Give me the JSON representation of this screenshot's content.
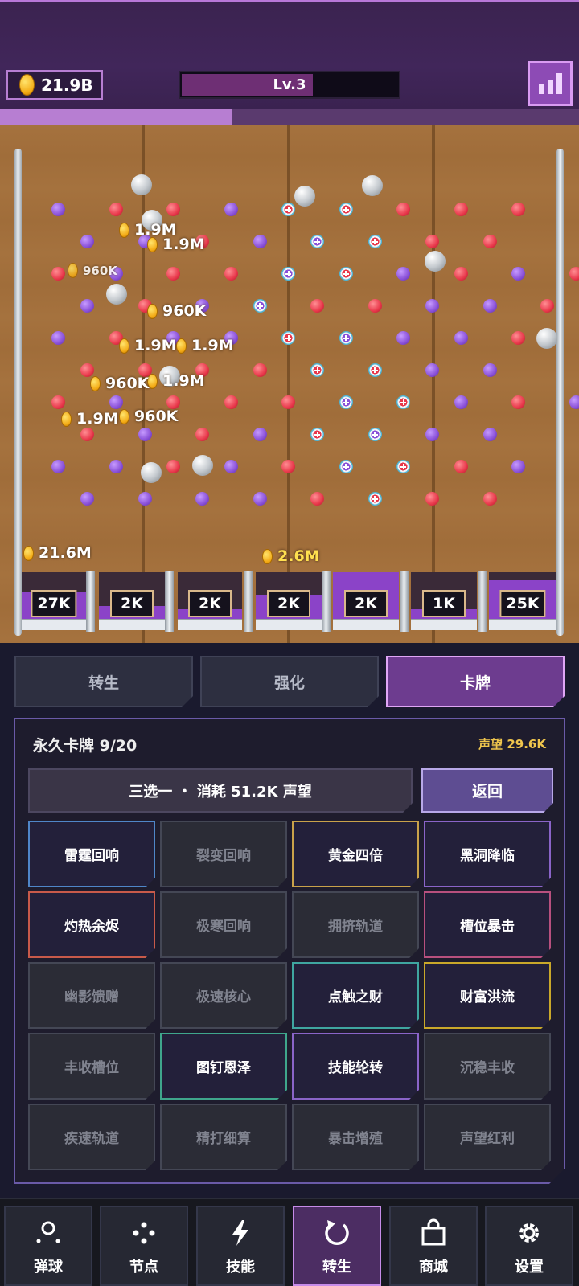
{
  "hud": {
    "gold": "21.9B",
    "level": "Lv.3",
    "level_progress": 0.6,
    "xp_progress": 0.4
  },
  "board": {
    "floating_values": [
      "1.9M",
      "1.9M",
      "960K",
      "960K",
      "1.9M",
      "1.9M",
      "1.9M",
      "960K",
      "1.9M",
      "960K"
    ],
    "slot_payouts": [
      "27K",
      "2K",
      "2K",
      "2K",
      "2K",
      "1K",
      "25K"
    ],
    "slot_winnings": [
      "21.6M",
      "2.6M"
    ]
  },
  "tabs": [
    {
      "label": "转生",
      "active": false
    },
    {
      "label": "强化",
      "active": false
    },
    {
      "label": "卡牌",
      "active": true
    }
  ],
  "cards": {
    "title": "永久卡牌 9/20",
    "prestige": "声望 29.6K",
    "pick_label": "三选一 ・ 消耗 51.2K 声望",
    "back_label": "返回",
    "items": [
      {
        "label": "雷霆回响",
        "owned": true,
        "color": "#4f86c8"
      },
      {
        "label": "裂变回响",
        "owned": false,
        "color": "#444755"
      },
      {
        "label": "黄金四倍",
        "owned": true,
        "color": "#c9a24a"
      },
      {
        "label": "黑洞降临",
        "owned": true,
        "color": "#8a64c8"
      },
      {
        "label": "灼热余烬",
        "owned": true,
        "color": "#c85a4a"
      },
      {
        "label": "极寒回响",
        "owned": false,
        "color": "#444755"
      },
      {
        "label": "拥挤轨道",
        "owned": false,
        "color": "#444755"
      },
      {
        "label": "槽位暴击",
        "owned": true,
        "color": "#b8507e"
      },
      {
        "label": "幽影馈赠",
        "owned": false,
        "color": "#444755"
      },
      {
        "label": "极速核心",
        "owned": false,
        "color": "#444755"
      },
      {
        "label": "点触之财",
        "owned": true,
        "color": "#3fa6a0"
      },
      {
        "label": "财富洪流",
        "owned": true,
        "color": "#c9a82a"
      },
      {
        "label": "丰收槽位",
        "owned": false,
        "color": "#444755"
      },
      {
        "label": "图钉恩泽",
        "owned": true,
        "color": "#3fa68c"
      },
      {
        "label": "技能轮转",
        "owned": true,
        "color": "#8a64c8"
      },
      {
        "label": "沉稳丰收",
        "owned": false,
        "color": "#444755"
      },
      {
        "label": "疾速轨道",
        "owned": false,
        "color": "#444755"
      },
      {
        "label": "精打细算",
        "owned": false,
        "color": "#444755"
      },
      {
        "label": "暴击增殖",
        "owned": false,
        "color": "#444755"
      },
      {
        "label": "声望红利",
        "owned": false,
        "color": "#444755"
      }
    ]
  },
  "nav": [
    {
      "label": "弹球",
      "icon": "pinball-icon",
      "active": false
    },
    {
      "label": "节点",
      "icon": "nodes-icon",
      "active": false
    },
    {
      "label": "技能",
      "icon": "lightning-icon",
      "active": false
    },
    {
      "label": "转生",
      "icon": "rebirth-icon",
      "active": true
    },
    {
      "label": "商城",
      "icon": "shop-bag-icon",
      "active": false
    },
    {
      "label": "设置",
      "icon": "gear-icon",
      "active": false
    }
  ]
}
